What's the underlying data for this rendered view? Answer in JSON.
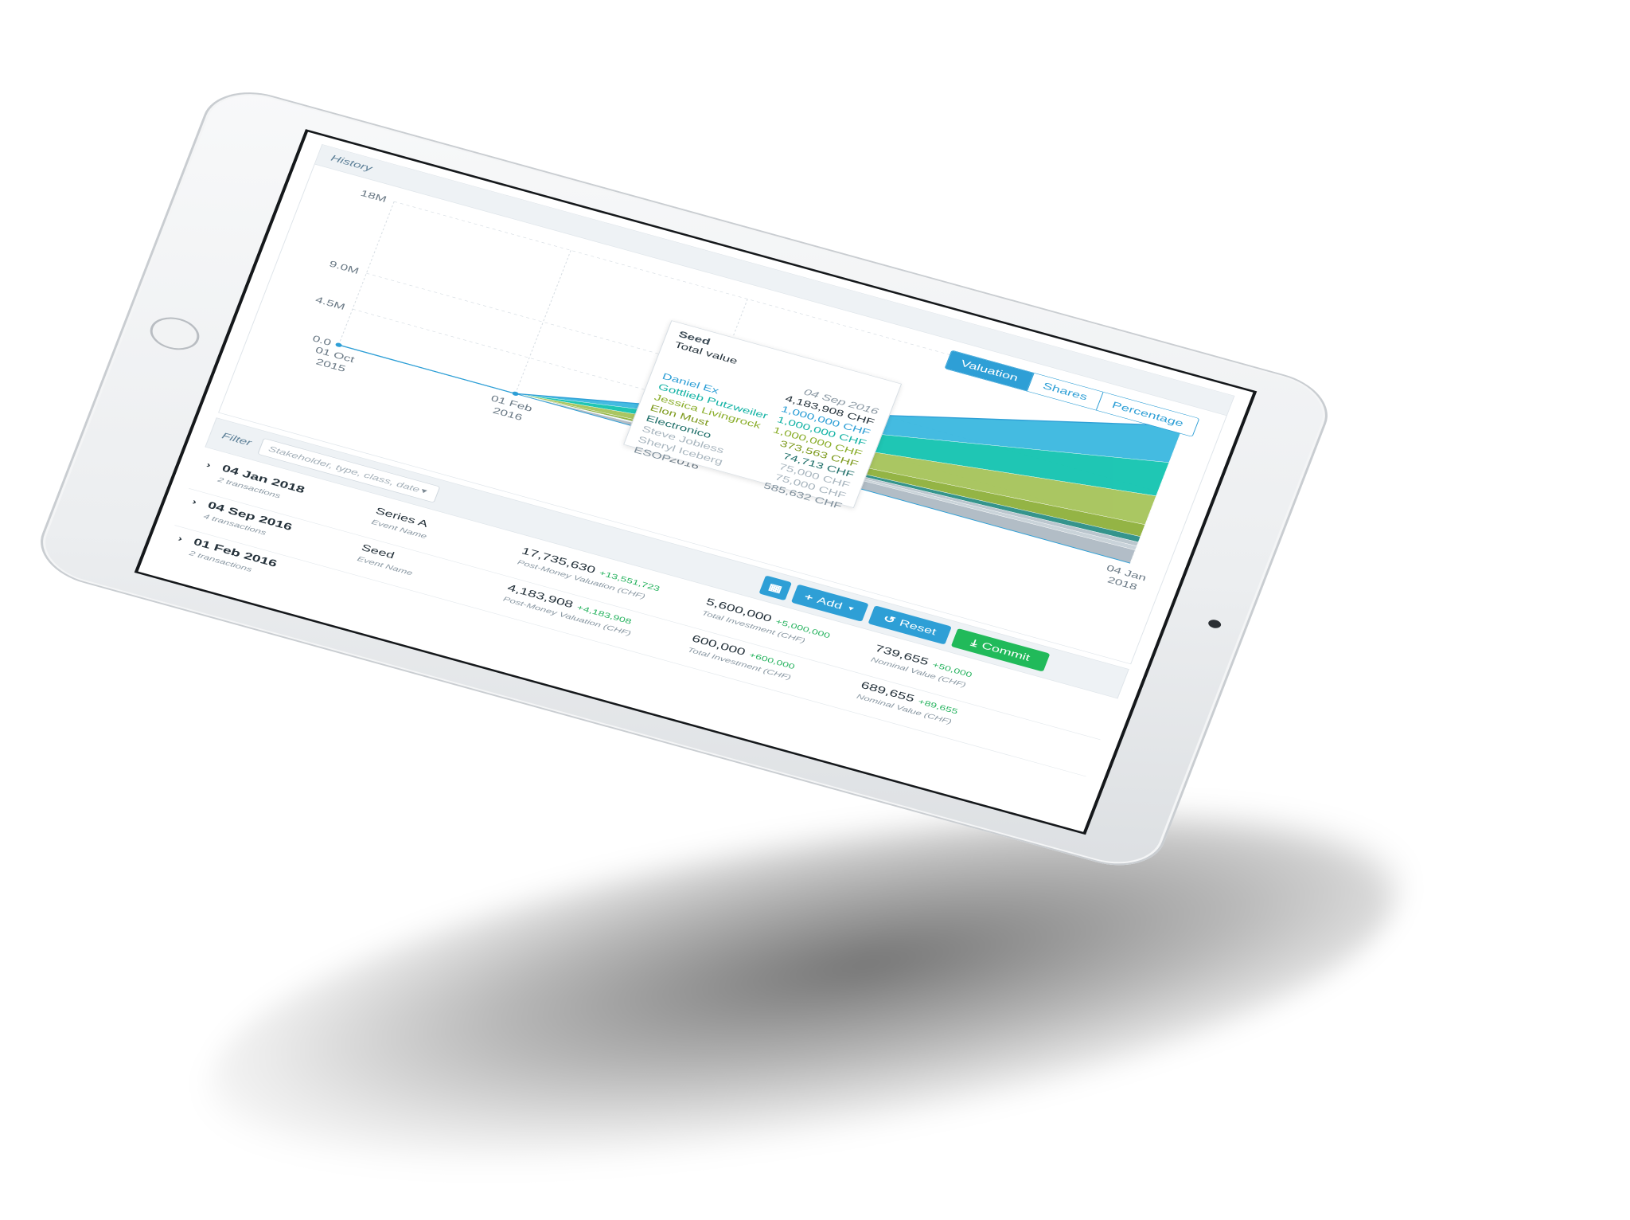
{
  "panel": {
    "title": "History"
  },
  "toggle": {
    "options": [
      "Valuation",
      "Shares",
      "Percentage"
    ],
    "active": "Valuation"
  },
  "chart_data": {
    "type": "area",
    "x": [
      "01 Oct 2015",
      "01 Feb 2016",
      "04 Sep 2016",
      "04 Jan 2018"
    ],
    "x_labels": [
      [
        "01 Oct",
        "2015"
      ],
      [
        "01 Feb",
        "2016"
      ],
      [
        "04 Sep",
        "2016"
      ],
      [
        "04 Jan",
        "2018"
      ]
    ],
    "y_ticks": [
      "0.0",
      "4.5M",
      "9.0M",
      "18M"
    ],
    "ylim": [
      0,
      18000000
    ],
    "series": [
      {
        "name": "Daniel Ex",
        "color": "#3ab8e0",
        "values": [
          0,
          0,
          1000000,
          4600000
        ]
      },
      {
        "name": "Gottlieb Putzweiler",
        "color": "#14c4b0",
        "values": [
          0,
          0,
          1000000,
          4200000
        ]
      },
      {
        "name": "Jessica Livingrock",
        "color": "#a6c45a",
        "values": [
          0,
          0,
          1000000,
          3600000
        ]
      },
      {
        "name": "Elon Must",
        "color": "#8fb03c",
        "values": [
          0,
          0,
          373563,
          1500000
        ]
      },
      {
        "name": "Electronico",
        "color": "#2b8f86",
        "values": [
          0,
          0,
          74713,
          700000
        ]
      },
      {
        "name": "Steve Jobless",
        "color": "#b8c4cc",
        "values": [
          0,
          0,
          75000,
          500000
        ]
      },
      {
        "name": "Sheryl Iceberg",
        "color": "#c7d1d8",
        "values": [
          0,
          0,
          75000,
          500000
        ]
      },
      {
        "name": "ESOP",
        "color": "#aebac4",
        "values": [
          0,
          0,
          585632,
          1635630
        ]
      }
    ],
    "tooltip": {
      "title": "Seed",
      "total_label": "Total value",
      "date": "04 Sep 2016",
      "total_value": "4,183,908 CHF",
      "rows": [
        {
          "name": "Daniel Ex",
          "value": "1,000,000 CHF",
          "color": "#2e9fd6"
        },
        {
          "name": "Gottlieb Putzweiler",
          "value": "1,000,000 CHF",
          "color": "#14b3a5"
        },
        {
          "name": "Jessica Livingrock",
          "value": "1,000,000 CHF",
          "color": "#8caf2e"
        },
        {
          "name": "Elon Must",
          "value": "373,563 CHF",
          "color": "#7d9a1d"
        },
        {
          "name": "Electronico",
          "value": "74,713 CHF",
          "color": "#1f6f69"
        },
        {
          "name": "Steve Jobless",
          "value": "75,000 CHF",
          "color": "#a9b6bf"
        },
        {
          "name": "Sheryl Iceberg",
          "value": "75,000 CHF",
          "color": "#a9b6bf"
        },
        {
          "name": "ESOP",
          "value": "585,632 CHF",
          "color": "#7f8f9b"
        }
      ]
    }
  },
  "filter": {
    "label": "Filter",
    "placeholder": "Stakeholder, type, class, date"
  },
  "actions": {
    "add": "Add",
    "reset": "Reset",
    "commit": "Commit"
  },
  "events": [
    {
      "date": "04 Jan 2018",
      "sub": "2 transactions",
      "name": "Series A",
      "name_label": "Event Name",
      "post_money": "17,735,630",
      "post_money_delta": "+13,551,723",
      "post_money_label": "Post-Money Valuation (CHF)",
      "investment": "5,600,000",
      "investment_delta": "+5,000,000",
      "investment_label": "Total Investment (CHF)",
      "nominal": "739,655",
      "nominal_delta": "+50,000",
      "nominal_label": "Nominal Value (CHF)"
    },
    {
      "date": "04 Sep 2016",
      "sub": "4 transactions",
      "name": "Seed",
      "name_label": "Event Name",
      "post_money": "4,183,908",
      "post_money_delta": "+4,183,908",
      "post_money_label": "Post-Money Valuation (CHF)",
      "investment": "600,000",
      "investment_delta": "+600,000",
      "investment_label": "Total Investment (CHF)",
      "nominal": "689,655",
      "nominal_delta": "+89,655",
      "nominal_label": "Nominal Value (CHF)"
    },
    {
      "date": "01 Feb 2016",
      "sub": "2 transactions"
    }
  ]
}
